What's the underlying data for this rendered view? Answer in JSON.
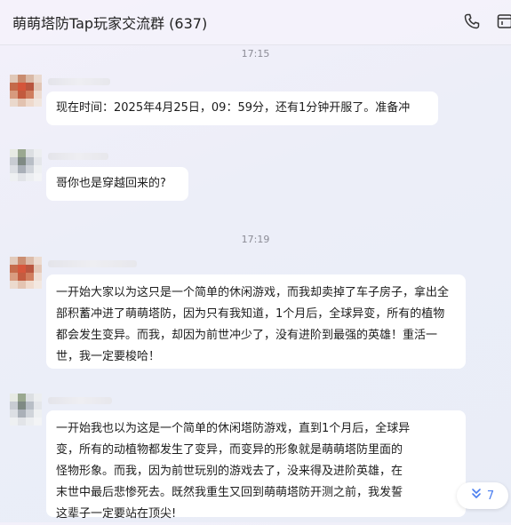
{
  "header": {
    "title": "萌萌塔防Tap玩家交流群 (637)",
    "icons": [
      "phone-icon",
      "window-icon"
    ]
  },
  "messages": [
    {
      "time": "17:15",
      "text": "现在时间：2025年4月25日，09：59分，还有1分钟开服了。准备冲"
    },
    {
      "text": "哥你也是穿越回来的?"
    },
    {
      "time": "17:19",
      "text": "一开始大家以为这只是一个简单的休闲游戏，而我却卖掉了车子房子，拿出全部积蓄冲进了萌萌塔防，因为只有我知道，1个月后，全球异变，所有的植物都会发生变异。而我，却因为前世冲少了，没有进阶到最强的英雄！重活一世，我一定要梭哈！"
    },
    {
      "text": "一开始我也以为这是一个简单的休闲塔防游戏，直到1个月后，全球异变，所有的动植物都发生了变异，而变异的形象就是萌萌塔防里面的怪物形象。而我，因为前世玩别的游戏去了，没来得及进阶英雄，在末世中最后悲惨死去。既然我重生又回到萌萌塔防开测之前，我发誓这辈子一定要站在顶尖!"
    }
  ],
  "unread_button": {
    "count": "7",
    "icon": "double-chevron-down-icon"
  },
  "colors": {
    "accent": "#4a7ef0",
    "bubble": "#ffffff",
    "timestamp": "#8c8c96"
  }
}
